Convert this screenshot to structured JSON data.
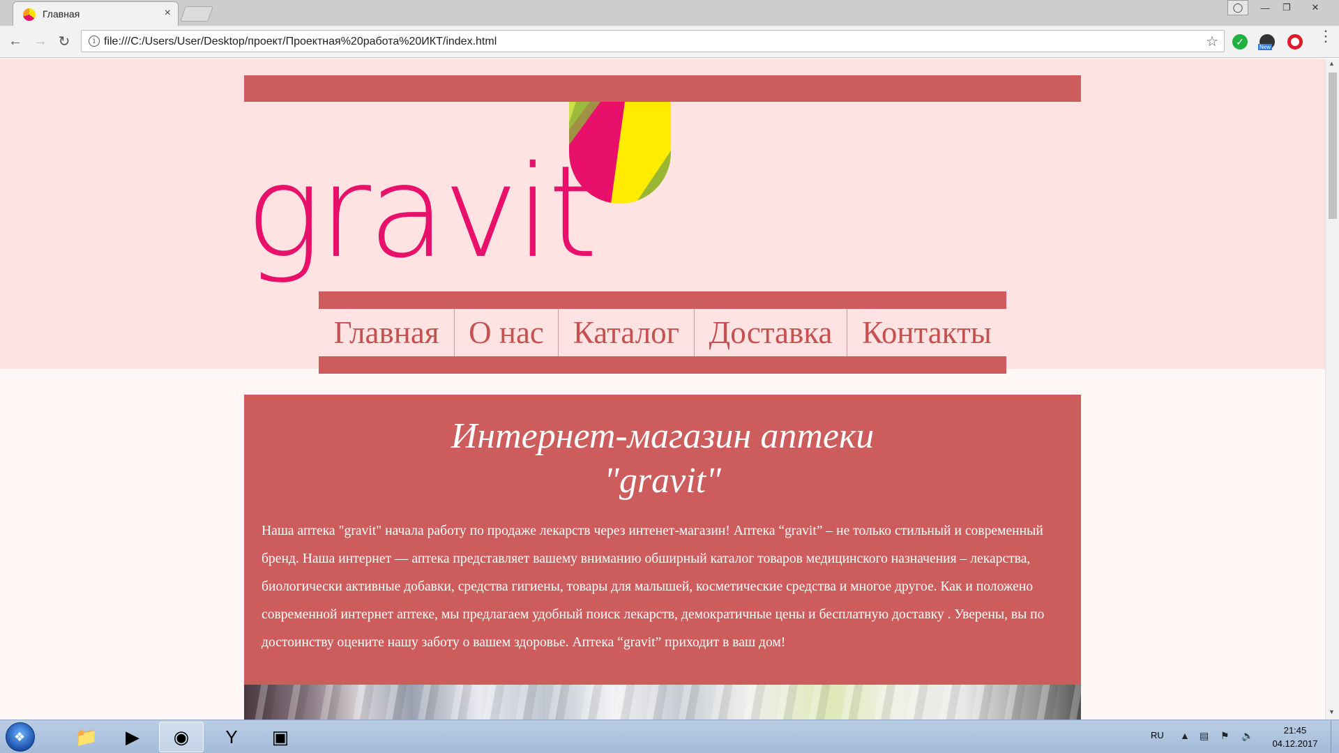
{
  "browser": {
    "tab_title": "Главная",
    "tab_close": "×",
    "url": "file:///C:/Users/User/Desktop/проект/Проектная%20работа%20ИКТ/index.html",
    "ext_new_badge": "New",
    "icons": [
      "back-icon",
      "forward-icon",
      "reload-icon",
      "info-icon",
      "star-icon",
      "menu-icon"
    ]
  },
  "site": {
    "logo_text": "gravit",
    "nav": [
      {
        "label": "Главная"
      },
      {
        "label": "О нас"
      },
      {
        "label": "Каталог"
      },
      {
        "label": "Доставка"
      },
      {
        "label": "Контакты"
      }
    ],
    "content": {
      "title_line1": "Интернет-магазин аптеки",
      "title_line2": "\"gravit\"",
      "text": "Наша аптека \"gravit\" начала работу по продаже лекарств через интенет-магазин! Аптека “gravit” – не только стильный и современный бренд. Наша интернет — аптека представляет вашему вниманию обширный каталог товаров медицинского назначения – лекарства, биологически активные добавки, средства гигиены, товары для малышей, косметические средства и многое другое. Как и положено современной интернет аптеке, мы предлагаем удобный поиск лекарств, демократичные цены и бесплатную доставку . Уверены, вы по достоинству оцените нашу заботу о вашем здоровье. Аптека “gravit” приходит в ваш дом!"
    },
    "colors": {
      "accent": "#cd5c5c",
      "header_bg": "#ffe3e2",
      "page_bg": "#fff8f7",
      "logo_pink": "#e8106a",
      "logo_yellow": "#ffec00",
      "logo_green": "#8fb13a"
    }
  },
  "taskbar": {
    "language": "RU",
    "time": "21:45",
    "date": "04.12.2017"
  }
}
